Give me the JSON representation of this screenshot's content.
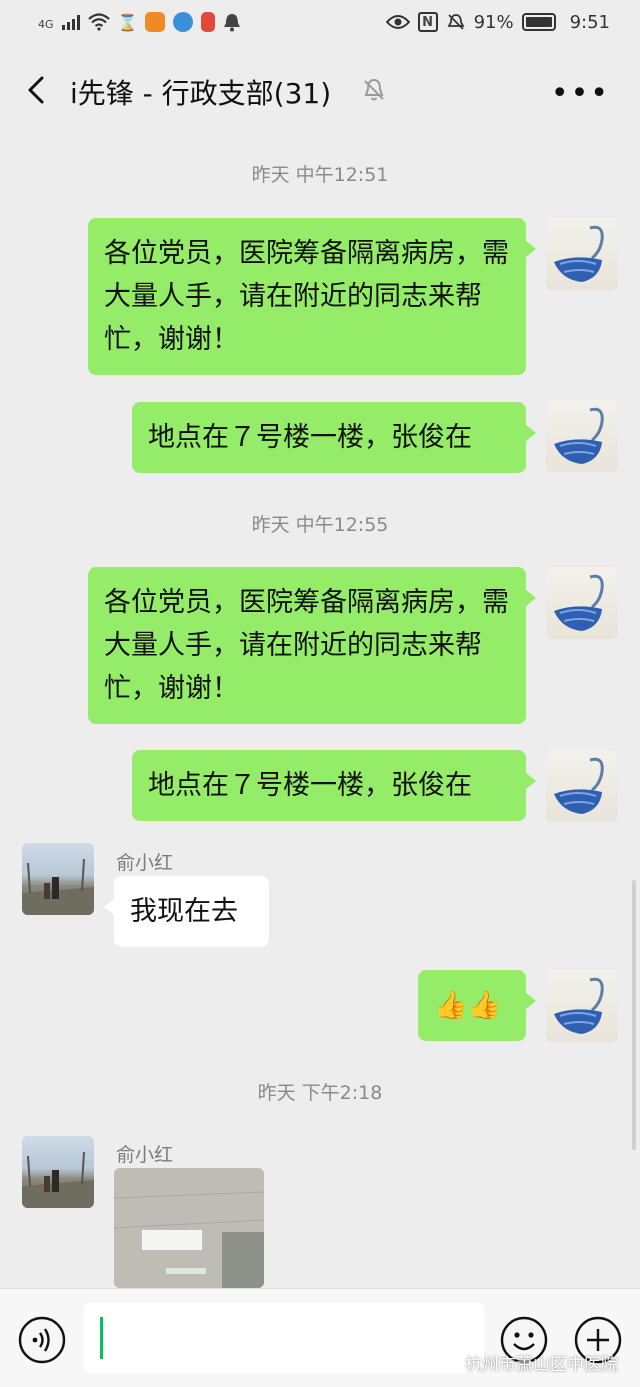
{
  "status_bar": {
    "network": "4G",
    "battery": "91%",
    "time": "9:51"
  },
  "header": {
    "title": "i先锋 - 行政支部(31)",
    "more": "•••"
  },
  "messages": [
    {
      "type": "time",
      "text": "昨天 中午12:51"
    },
    {
      "type": "me",
      "text": "各位党员，医院筹备隔离病房，需大量人手，请在附近的同志来帮忙，谢谢！"
    },
    {
      "type": "me",
      "text": "地点在７号楼一楼，张俊在"
    },
    {
      "type": "time",
      "text": "昨天 中午12:55"
    },
    {
      "type": "me",
      "text": "各位党员，医院筹备隔离病房，需大量人手，请在附近的同志来帮忙，谢谢！"
    },
    {
      "type": "me",
      "text": "地点在７号楼一楼，张俊在"
    },
    {
      "type": "other",
      "sender": "俞小红",
      "text": "我现在去"
    },
    {
      "type": "me",
      "text": "👍👍"
    },
    {
      "type": "time",
      "text": "昨天 下午2:18"
    },
    {
      "type": "other_image",
      "sender": "俞小红"
    }
  ],
  "bubble_lines": {
    "m1": [
      "各位党员，医院筹备隔离病房，",
      "需大量人手，请在附近的同志",
      "来帮忙，谢谢！"
    ]
  },
  "watermark": "杭州市萧山区中医院",
  "colors": {
    "my_bubble": "#95ec69",
    "other_bubble": "#ffffff",
    "background": "#ededed",
    "caret": "#07c160"
  },
  "icons": [
    "back-icon",
    "mute-icon",
    "more-icon",
    "voice-icon",
    "emoji-icon",
    "plus-icon"
  ]
}
